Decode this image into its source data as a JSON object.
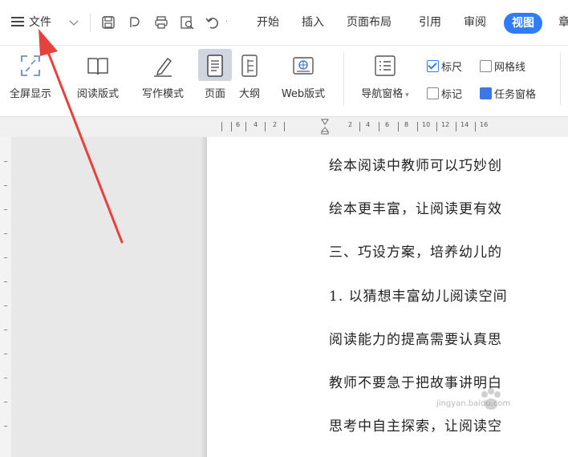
{
  "menubar": {
    "file_label": "文件",
    "tabs": [
      "开始",
      "插入",
      "页面布局",
      "引用",
      "审阅"
    ],
    "active_tab": "视图",
    "cut_tab": "章"
  },
  "ribbon": {
    "buttons": [
      "全屏显示",
      "阅读版式",
      "写作模式",
      "页面",
      "大纲",
      "Web版式"
    ],
    "nav_pane": "导航窗格",
    "checkboxes": {
      "ruler": "标尺",
      "gridlines": "网格线",
      "marks": "标记",
      "task_pane": "任务窗格"
    }
  },
  "ruler": {
    "left_marks": [
      "6",
      "4",
      "2"
    ],
    "right_marks": [
      "2",
      "4",
      "6",
      "8",
      "10",
      "12",
      "14",
      "16"
    ]
  },
  "document": {
    "lines": [
      "绘本阅读中教师可以巧妙创",
      "绘本更丰富，让阅读更有效",
      "三、巧设方案，培养幼儿的",
      "1. 以猜想丰富幼儿阅读空间",
      "阅读能力的提高需要认真思",
      "教师不要急于把故事讲明白",
      "思考中自主探索，让阅读空"
    ]
  },
  "watermark": {
    "text": "jingyan.baidu.com"
  },
  "colors": {
    "accent": "#2e7cf6",
    "arrow": "#e8413b"
  }
}
